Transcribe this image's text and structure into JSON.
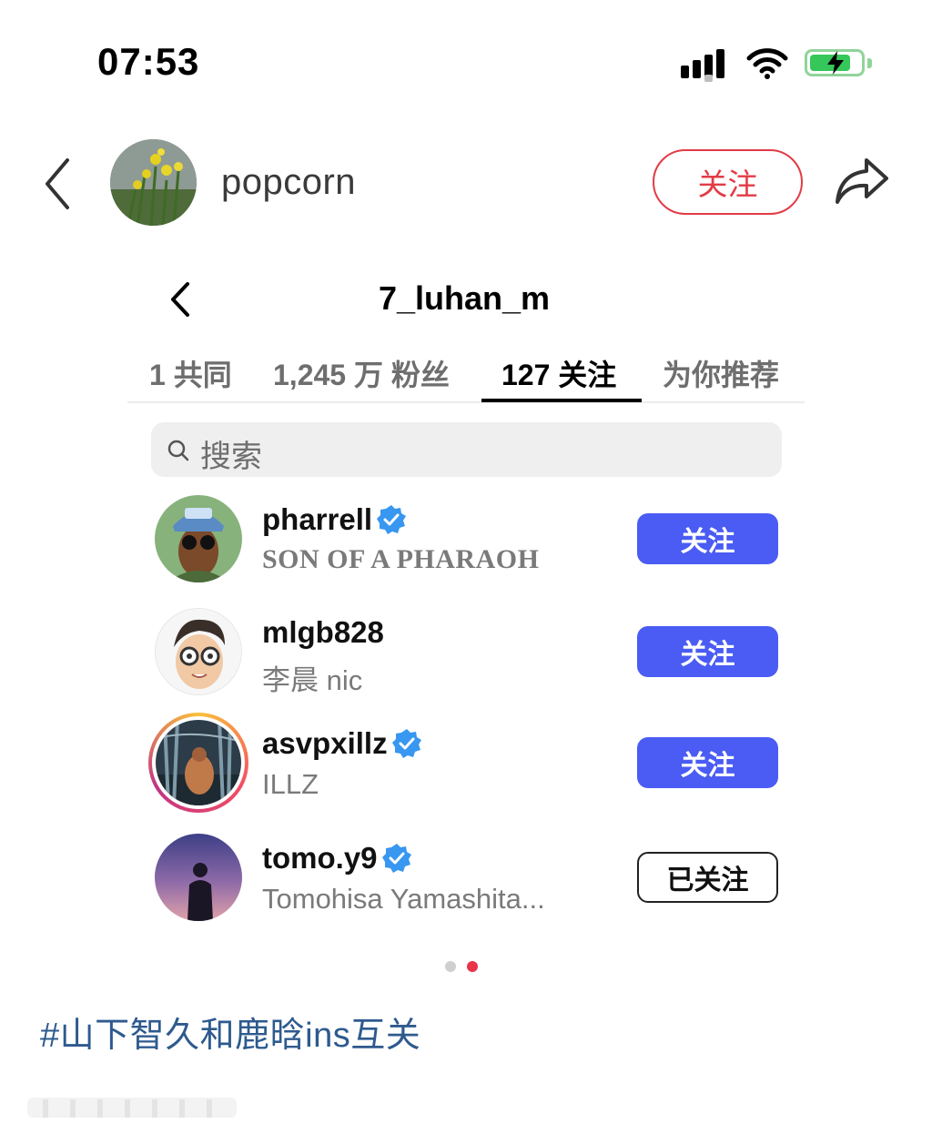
{
  "status_bar": {
    "time": "07:53",
    "battery_level": 0.82,
    "battery_charging": true
  },
  "profile": {
    "name": "popcorn",
    "follow_label": "关注"
  },
  "inner": {
    "title": "7_luhan_m",
    "tabs": [
      {
        "label": "1 共同",
        "active": false
      },
      {
        "label": "1,245 万 粉丝",
        "active": false
      },
      {
        "label": "127 关注",
        "active": true
      },
      {
        "label": "为你推荐",
        "active": false
      }
    ],
    "search_placeholder": "搜索",
    "users": [
      {
        "handle": "pharrell",
        "subtitle": "SON OF A PHARAOH",
        "verified": true,
        "button": "关注",
        "following": false
      },
      {
        "handle": "mlgb828",
        "subtitle": "李晨 nic",
        "verified": false,
        "button": "关注",
        "following": false
      },
      {
        "handle": "asvpxillz",
        "subtitle": "ILLZ",
        "verified": true,
        "button": "关注",
        "following": false
      },
      {
        "handle": "tomo.y9",
        "subtitle": "Tomohisa Yamashita...",
        "verified": true,
        "button": "已关注",
        "following": true
      }
    ],
    "page_indicator": {
      "pages": 2,
      "active_index": 1
    }
  },
  "hashtag": "#山下智久和鹿晗ins互关",
  "colors": {
    "follow_red": "#e33b45",
    "follow_blue": "#4a5cf3",
    "verified_blue": "#3897f0",
    "hashtag_blue": "#2e5a8e",
    "dot_active": "#e8334a",
    "dot_inactive": "#cfcfcf"
  },
  "icons": [
    "back-icon",
    "share-icon",
    "search-icon",
    "verified-badge-icon",
    "wifi-icon",
    "battery-icon",
    "signal-icon"
  ]
}
